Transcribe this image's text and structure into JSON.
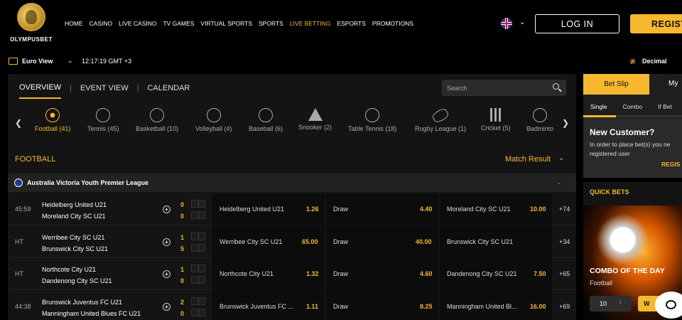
{
  "brand": {
    "name": "OLYMPUSBET"
  },
  "nav": [
    "HOME",
    "CASINO",
    "LIVE CASINO",
    "TV GAMES",
    "VIRTUAL SPORTS",
    "SPORTS",
    "LIVE BETTING",
    "ESPORTS",
    "PROMOTIONS"
  ],
  "nav_active": "LIVE BETTING",
  "header": {
    "login_label": "LOG IN",
    "register_label": "REGIST"
  },
  "subbar": {
    "view_label": "Euro View",
    "clock": "12:17:19 GMT +3",
    "odds_format": "Decimal"
  },
  "tabs": [
    "OVERVIEW",
    "EVENT VIEW",
    "CALENDAR"
  ],
  "search": {
    "placeholder": "Search"
  },
  "sports": [
    {
      "label": "Football (41)",
      "icon": "football-icon"
    },
    {
      "label": "Tennis (45)",
      "icon": "tennis-icon"
    },
    {
      "label": "Basketball (10)",
      "icon": "basketball-icon"
    },
    {
      "label": "Volleyball (4)",
      "icon": "volleyball-icon"
    },
    {
      "label": "Baseball (6)",
      "icon": "baseball-icon"
    },
    {
      "label": "Snooker (2)",
      "icon": "snooker-icon"
    },
    {
      "label": "Table Tennis (18)",
      "icon": "table-tennis-icon"
    },
    {
      "label": "Rugby League (1)",
      "icon": "rugby-icon"
    },
    {
      "label": "Cricket (5)",
      "icon": "cricket-icon"
    },
    {
      "label": "Badminto",
      "icon": "badminton-icon"
    }
  ],
  "section": {
    "title": "FOOTBALL",
    "market": "Match Result"
  },
  "league": {
    "name": "Australia Victoria Youth Premier League"
  },
  "matches": [
    {
      "time": "45:59",
      "home": "Heidelberg United U21",
      "away": "Moreland City SC U21",
      "home_score": "0",
      "away_score": "0",
      "o1_name": "Heidelberg United U21",
      "o1": "1.26",
      "ox_name": "Draw",
      "ox": "4.40",
      "o2_name": "Moreland City SC U21",
      "o2": "10.00",
      "more": "+74"
    },
    {
      "time": "HT",
      "home": "Werribee City SC U21",
      "away": "Brunswick City SC U21",
      "home_score": "1",
      "away_score": "5",
      "o1_name": "Werribee City SC U21",
      "o1": "65.00",
      "ox_name": "Draw",
      "ox": "40.00",
      "o2_name": "Brunswick City SC U21",
      "o2": "",
      "more": "+34"
    },
    {
      "time": "HT",
      "home": "Northcote City U21",
      "away": "Dandenong City SC U21",
      "home_score": "1",
      "away_score": "0",
      "o1_name": "Northcote City U21",
      "o1": "1.32",
      "ox_name": "Draw",
      "ox": "4.60",
      "o2_name": "Dandenong City SC U21",
      "o2": "7.50",
      "more": "+65"
    },
    {
      "time": "44:38",
      "home": "Brunswick Juventus FC U21",
      "away": "Manningham United Blues FC U21",
      "home_score": "2",
      "away_score": "0",
      "o1_name": "Brunswick Juventus FC ...",
      "o1": "1.11",
      "ox_name": "Draw",
      "ox": "8.25",
      "o2_name": "Manningham United Bl...",
      "o2": "16.00",
      "more": "+69"
    }
  ],
  "betslip": {
    "tab_label": "Bet Slip",
    "my_tab_label": "My",
    "types": [
      "Single",
      "Combo",
      "If Bet"
    ],
    "new_customer_title": "New Customer?",
    "new_customer_text": "In order to place bet(s) you ne registered user",
    "register_link": "REGIS"
  },
  "quickbets": {
    "title": "QUICK BETS",
    "combo_title": "COMBO OF THE DAY",
    "sport": "Football",
    "stake": "10",
    "button": "W"
  },
  "colors": {
    "accent": "#f5b82e",
    "panel": "#141414",
    "background": "#000000"
  }
}
